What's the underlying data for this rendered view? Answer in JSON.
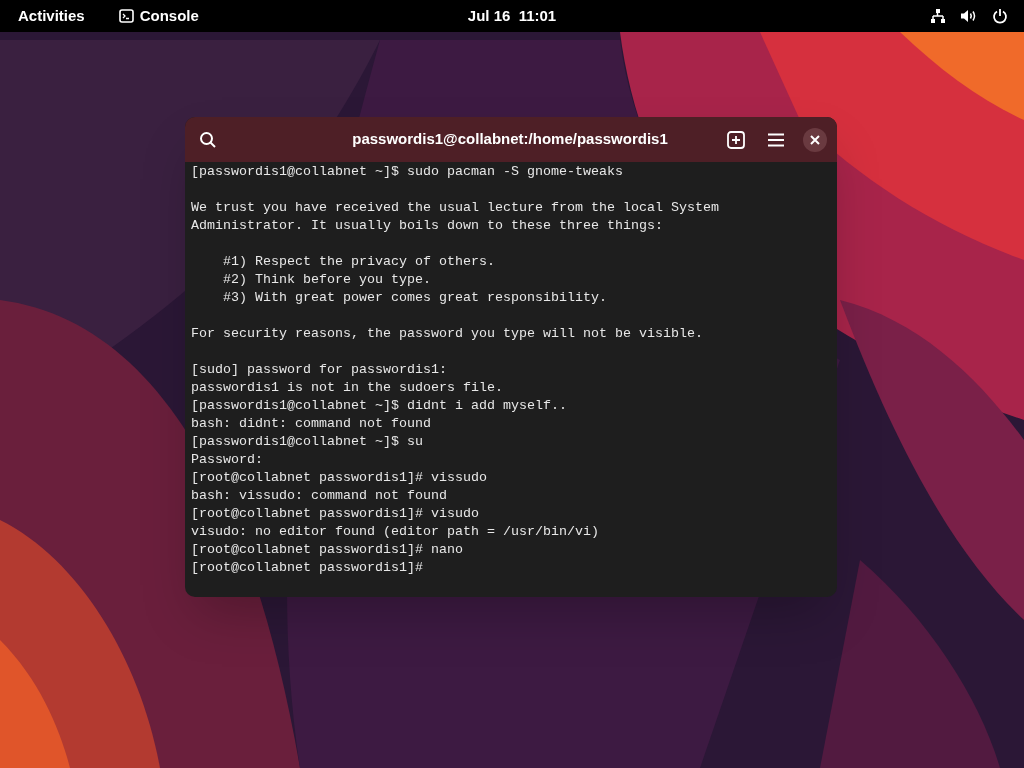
{
  "top_bar": {
    "activities": "Activities",
    "app": {
      "label": "Console"
    },
    "clock": "Jul 16  11:01"
  },
  "terminal": {
    "title": "passwordis1@collabnet:/home/passwordis1",
    "blocks": [
      [
        "[passwordis1@collabnet ~]$ sudo pacman -S gnome-tweaks"
      ],
      [
        "We trust you have received the usual lecture from the local System",
        "Administrator. It usually boils down to these three things:"
      ],
      [
        "    #1) Respect the privacy of others.",
        "    #2) Think before you type.",
        "    #3) With great power comes great responsibility."
      ],
      [
        "For security reasons, the password you type will not be visible."
      ],
      [
        "[sudo] password for passwordis1:",
        "passwordis1 is not in the sudoers file.",
        "[passwordis1@collabnet ~]$ didnt i add myself..",
        "bash: didnt: command not found",
        "[passwordis1@collabnet ~]$ su",
        "Password:",
        "[root@collabnet passwordis1]# vissudo",
        "bash: vissudo: command not found",
        "[root@collabnet passwordis1]# visudo",
        "visudo: no editor found (editor path = /usr/bin/vi)",
        "[root@collabnet passwordis1]# nano",
        "[root@collabnet passwordis1]#"
      ]
    ]
  }
}
